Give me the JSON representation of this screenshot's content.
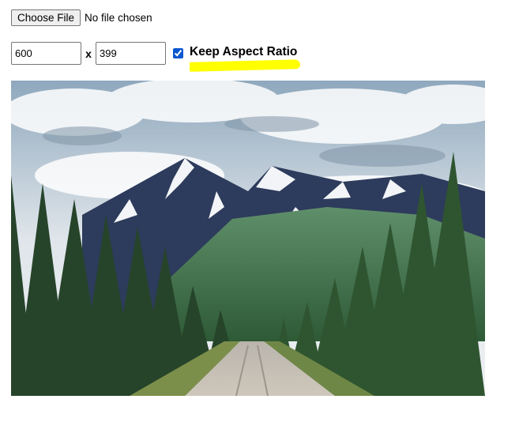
{
  "file_picker": {
    "button_label": "Choose File",
    "status_text": "No file chosen"
  },
  "dimensions": {
    "width_value": "600",
    "separator": "x",
    "height_value": "399"
  },
  "aspect": {
    "checked": true,
    "label": "Keep Aspect Ratio",
    "highlight_color": "#ffff00"
  },
  "preview": {
    "subject": "mountain landscape with forest and gravel road"
  }
}
